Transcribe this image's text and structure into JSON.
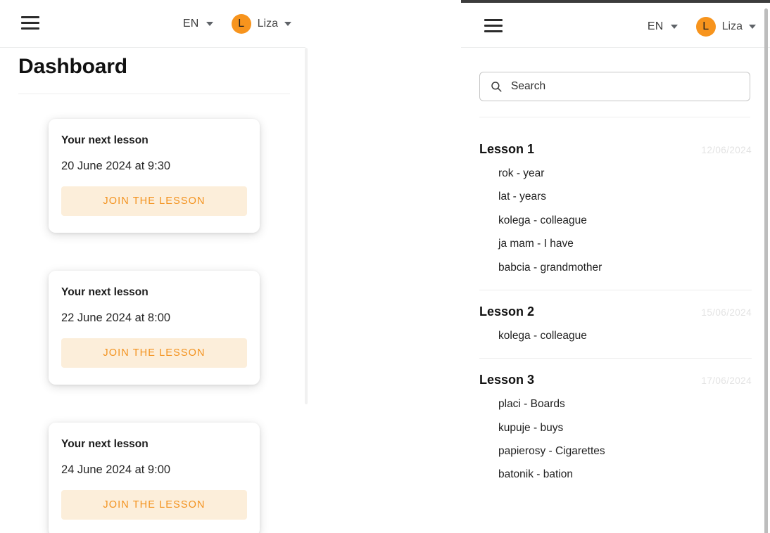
{
  "left_window": {
    "header": {
      "menu_icon": "hamburger-menu-icon",
      "language": "EN",
      "language_caret": "chevron-down-icon",
      "avatar_initial": "L",
      "user_name": "Liza",
      "user_caret": "chevron-down-icon"
    },
    "page_title": "Dashboard",
    "cards": [
      {
        "title": "Your next lesson",
        "date": "20 June 2024 at 9:30",
        "button_label": "JOIN THE LESSON"
      },
      {
        "title": "Your next lesson",
        "date": "22 June 2024 at 8:00",
        "button_label": "JOIN THE LESSON"
      },
      {
        "title": "Your next lesson",
        "date": "24 June 2024 at 9:00",
        "button_label": "JOIN THE LESSON"
      }
    ]
  },
  "right_window": {
    "header": {
      "menu_icon": "hamburger-menu-icon",
      "language": "EN",
      "language_caret": "chevron-down-icon",
      "avatar_initial": "L",
      "user_name": "Liza",
      "user_caret": "chevron-down-icon"
    },
    "search": {
      "icon": "search-icon",
      "placeholder": "Search",
      "value": ""
    },
    "lessons": [
      {
        "name": "Lesson 1",
        "date": "12/06/2024",
        "words": [
          "rok - year",
          "lat - years",
          "kolega - colleague",
          "ja mam - I have",
          "babcia - grandmother"
        ]
      },
      {
        "name": "Lesson 2",
        "date": "15/06/2024",
        "words": [
          "kolega - colleague"
        ]
      },
      {
        "name": "Lesson 3",
        "date": "17/06/2024",
        "words": [
          "placi - Boards",
          "kupuje - buys",
          "papierosy - Cigarettes",
          "batonik - bation"
        ]
      }
    ]
  },
  "colors": {
    "accent_orange": "#f7941d",
    "button_text": "#f3921e",
    "button_bg": "#fceeda",
    "text_primary": "#1f1f1f",
    "date_muted": "#e3e3e3",
    "divider": "#ededed"
  }
}
